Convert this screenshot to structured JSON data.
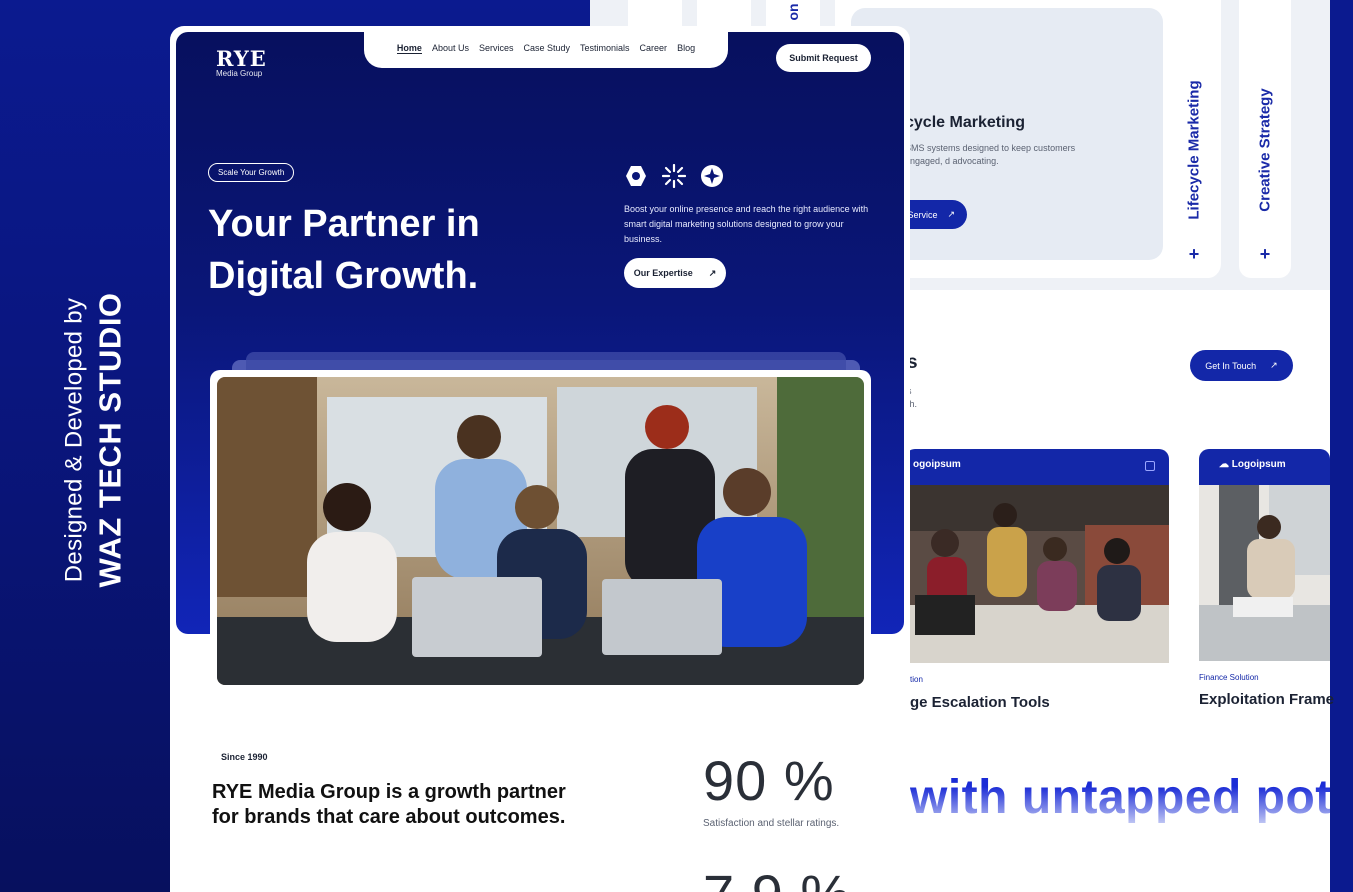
{
  "credit": {
    "line1": "Designed & Developed by",
    "line2": "WAZ TECH STUDIO"
  },
  "nav": {
    "brand_mark": "RYE",
    "brand_sub": "Media Group",
    "items": [
      "Home",
      "About Us",
      "Services",
      "Case Study",
      "Testimonials",
      "Career",
      "Blog"
    ],
    "active": "Home",
    "submit_label": "Submit Request"
  },
  "hero": {
    "badge": "Scale Your Growth",
    "headline": "Your Partner in Digital Growth.",
    "description": "Boost your online presence and reach the right audience with smart digital marketing solutions designed to grow your business.",
    "cta_label": "Our Expertise",
    "cta_arrow": "↗",
    "icons": [
      "hexagon-icon",
      "sunburst-icon",
      "sparkle-circle-icon"
    ]
  },
  "about": {
    "since": "Since 1990",
    "statement": "RYE Media Group is a growth partner for brands that care about outcomes.",
    "stat1_value": "90 %",
    "stat1_label": "Satisfaction and stellar ratings.",
    "stat2_value": "7 9 %"
  },
  "services_panel": {
    "title": "cycle Marketing",
    "description": "SMS systems designed to keep customers engaged, d advocating.",
    "button_label": "Service",
    "tabs": [
      "Lifecycle Marketing",
      "Creative Strategy"
    ],
    "top_fragment": "on",
    "tab_plus": "+"
  },
  "case_section": {
    "title_fragment": "s",
    "desc_fragment": "s\nth.",
    "cta_label": "Get In Touch",
    "cards": [
      {
        "logo": "ogoipsum",
        "tag": "tion",
        "title": "ge Escalation Tools"
      },
      {
        "logo": "Logoipsum",
        "tag": "Finance Solution",
        "title": "Exploitation Frame"
      }
    ]
  },
  "marquee": "with untapped pot",
  "colors": {
    "navy": "#07105e",
    "brand_blue": "#1327a8",
    "white": "#ffffff"
  }
}
